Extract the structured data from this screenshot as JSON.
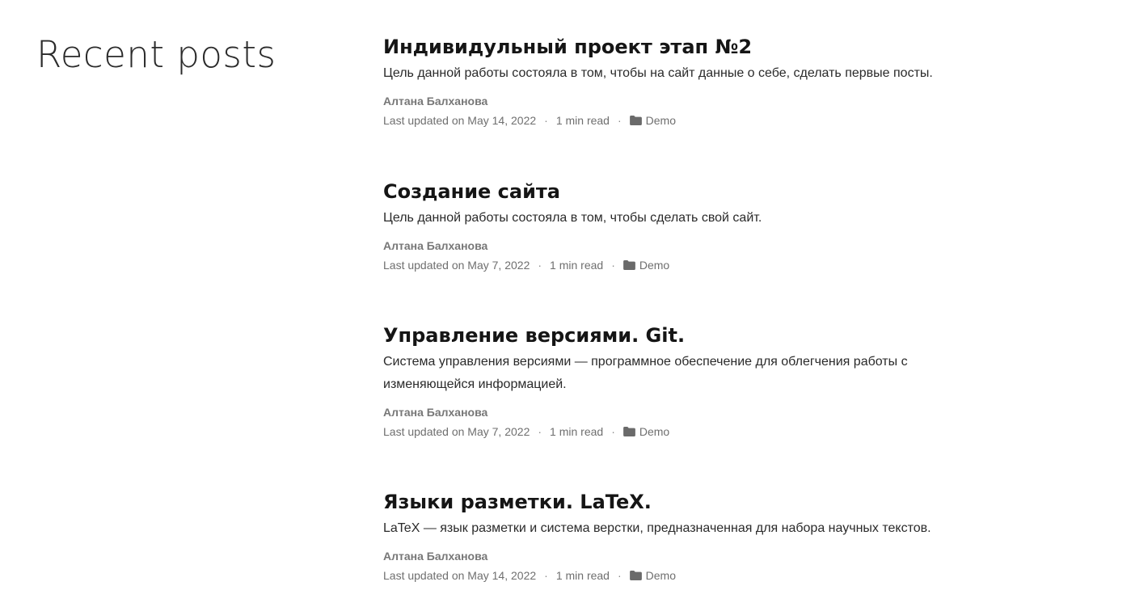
{
  "section": {
    "heading": "Recent posts"
  },
  "posts": [
    {
      "title": "Индивидульный проект этап №2",
      "summary": "Цель данной работы состояла в том, чтобы на сайт данные о себе, сделать первые посты.",
      "author": "Алтана Балханова",
      "updated": "Last updated on May 14, 2022",
      "read_time": "1 min read",
      "category": "Demo",
      "category_icon": "folder-icon"
    },
    {
      "title": "Создание сайта",
      "summary": "Цель данной работы состояла в том, чтобы сделать свой сайт.",
      "author": "Алтана Балханова",
      "updated": "Last updated on May 7, 2022",
      "read_time": "1 min read",
      "category": "Demo",
      "category_icon": "folder-icon"
    },
    {
      "title": "Управление версиями. Git.",
      "summary": "Система управления версиями — программное обеспечение для облегчения работы с изменяющейся информацией.",
      "author": "Алтана Балханова",
      "updated": "Last updated on May 7, 2022",
      "read_time": "1 min read",
      "category": "Demo",
      "category_icon": "folder-icon"
    },
    {
      "title": "Языки разметки. LaTeX.",
      "summary": "LaTeX — язык разметки и система верстки, предназначенная для набора научных текстов.",
      "author": "Алтана Балханова",
      "updated": "Last updated on May 14, 2022",
      "read_time": "1 min read",
      "category": "Demo",
      "category_icon": "folder-icon"
    }
  ],
  "meta_separator": "·",
  "colors": {
    "title": "#151515",
    "text": "#2a2a2a",
    "meta": "#6f6f6f",
    "author": "#777777",
    "background": "#ffffff"
  }
}
